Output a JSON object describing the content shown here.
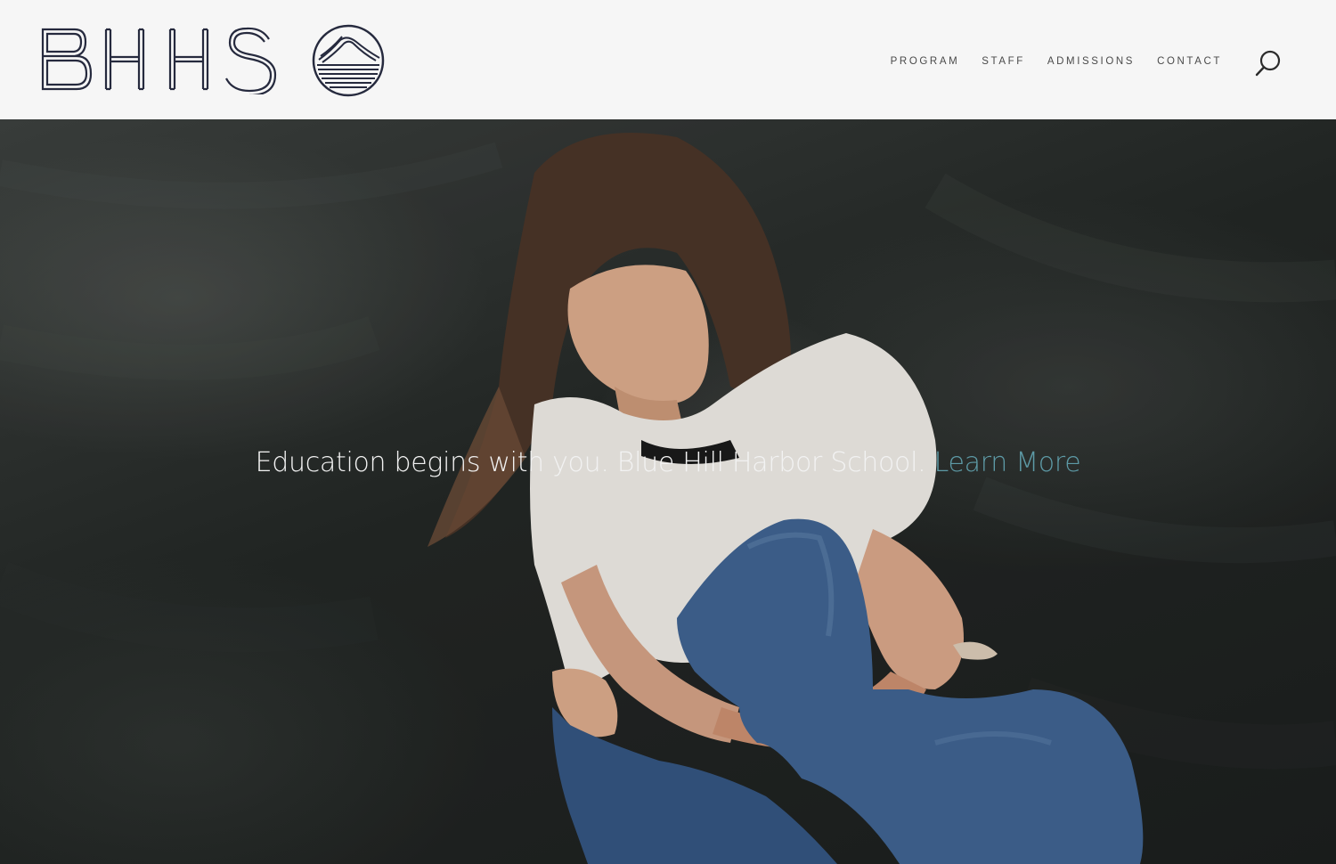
{
  "brand": {
    "name": "BHHS",
    "logo_icon": "mountain-waves-circle-logo"
  },
  "nav": {
    "items": [
      {
        "label": "PROGRAM"
      },
      {
        "label": "STAFF"
      },
      {
        "label": "ADMISSIONS"
      },
      {
        "label": "CONTACT"
      }
    ],
    "search_icon": "search-icon"
  },
  "hero": {
    "tagline": "Education begins with you. Blue Hill Harbor School.",
    "cta_label": "Learn More",
    "image": "hero-photo-girl-white-tshirt-jeans-on-dark-soil"
  },
  "colors": {
    "header_bg": "#f6f6f6",
    "logo_ink": "#262a3e",
    "nav_text": "#4a4a4a",
    "cta_accent": "#5d9aa6",
    "tagline_text": "#f2f2f2"
  }
}
